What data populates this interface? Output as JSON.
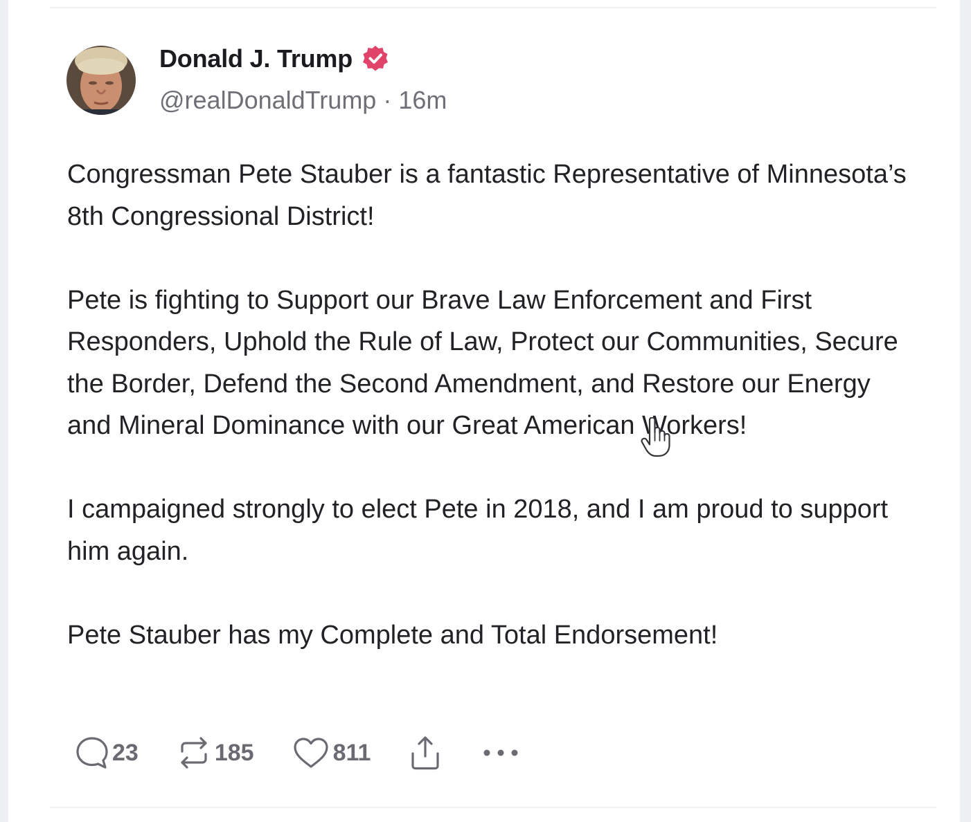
{
  "post": {
    "author": {
      "display_name": "Donald J. Trump",
      "handle": "@realDonaldTrump",
      "separator": "·",
      "timestamp": "16m",
      "verified": true
    },
    "paragraphs": [
      "Congressman Pete Stauber is a fantastic Representative of Minnesota’s 8th Congressional District!",
      "Pete is fighting to Support our Brave Law Enforcement and First Responders, Uphold the Rule of Law, Protect our Communities, Secure the Border, Defend the Second Amendment, and Restore our Energy and Mineral Dominance with our Great American Workers!",
      "I campaigned strongly to elect Pete in 2018, and I am proud to support him again.",
      "Pete Stauber has my Complete and Total Endorsement!"
    ],
    "actions": {
      "reply": {
        "icon": "reply-icon",
        "count": "23"
      },
      "repost": {
        "icon": "repost-icon",
        "count": "185"
      },
      "like": {
        "icon": "heart-icon",
        "count": "811"
      },
      "share": {
        "icon": "share-icon"
      },
      "more": {
        "icon": "more-icon"
      }
    }
  },
  "colors": {
    "verified_badge": "#e0446a",
    "text_primary": "#222226",
    "text_secondary": "#6f6f78",
    "action_icon": "#6a6a72",
    "page_background": "#eef0f3",
    "card_background": "#ffffff"
  }
}
